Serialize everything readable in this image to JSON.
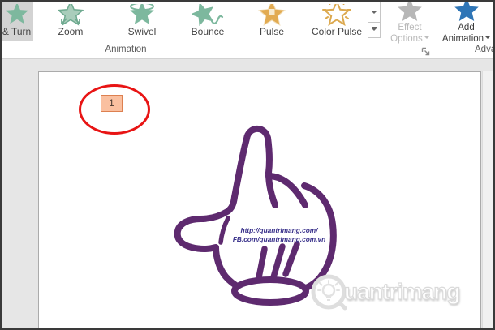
{
  "ribbon": {
    "gallery": {
      "items": [
        {
          "label": "& Turn",
          "icon": "green-star-icon",
          "selected": true
        },
        {
          "label": "Zoom",
          "icon": "green-star-zoom-icon",
          "selected": false
        },
        {
          "label": "Swivel",
          "icon": "green-star-swivel-icon",
          "selected": false
        },
        {
          "label": "Bounce",
          "icon": "green-star-bounce-icon",
          "selected": false
        },
        {
          "label": "Pulse",
          "icon": "gold-star-pulse-icon",
          "selected": false
        },
        {
          "label": "Color Pulse",
          "icon": "gold-star-colorpulse-icon",
          "selected": false
        }
      ]
    },
    "effect_options": {
      "line1": "Effect",
      "line2": "Options",
      "disabled": true
    },
    "add_animation": {
      "line1": "Add",
      "line2": "Animation"
    },
    "group_labels": {
      "animation": "Animation",
      "advanced_partial": "Adva"
    }
  },
  "slide": {
    "animation_badge": "1",
    "hand_text_line1": "http://quantrimang.com/",
    "hand_text_line2": "FB.com/quantrimang.com.vn",
    "watermark_letters": "uantrimang",
    "watermark_full": "Quantrimang"
  },
  "colors": {
    "accent_green": "#7db89e",
    "accent_gold": "#dfa84f",
    "accent_blue": "#2e75b6",
    "disabled_gray": "#b7b7b7",
    "hand_purple": "#5e2a6f",
    "hand_text_navy": "#38308a",
    "badge_fill": "#fac0a0",
    "badge_border": "#dd8050",
    "annotation_red": "#e81414",
    "selected_item_bg": "#d3d3d3"
  }
}
